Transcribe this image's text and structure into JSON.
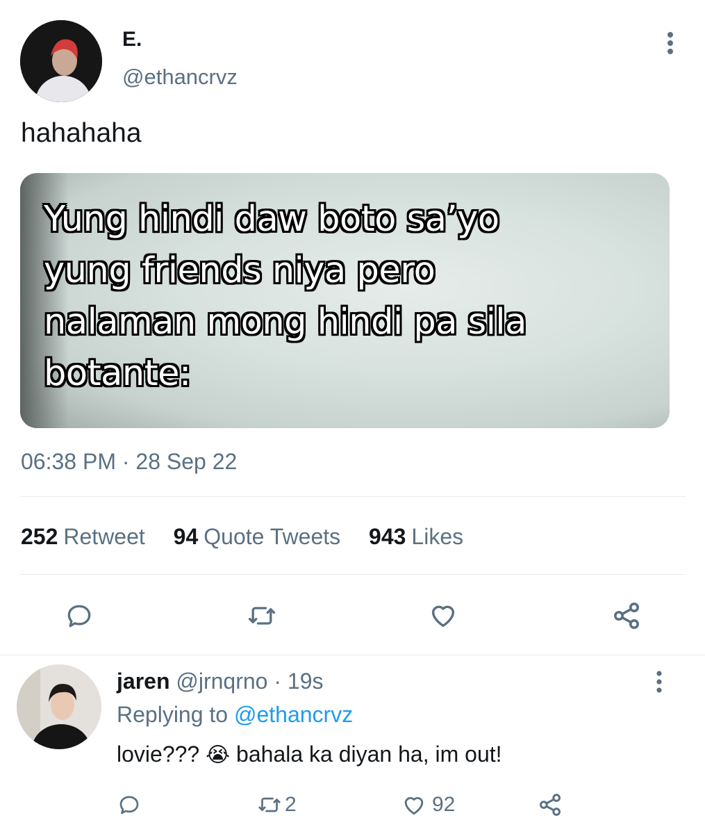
{
  "tweet": {
    "display_name": "E.",
    "handle": "@ethancrvz",
    "text": "hahahaha",
    "media_caption": [
      "Yung hindi daw boto sa’yo",
      "yung friends niya pero",
      "nalaman mong hindi pa sila",
      "botante:"
    ],
    "timestamp": "06:38 PM · 28 Sep 22",
    "stats": {
      "retweets_count": "252",
      "retweets_label": "Retweet",
      "quotes_count": "94",
      "quotes_label": "Quote Tweets",
      "likes_count": "943",
      "likes_label": "Likes"
    },
    "actions": [
      "reply-icon",
      "retweet-icon",
      "like-icon",
      "share-icon"
    ]
  },
  "reply": {
    "display_name": "jaren",
    "handle": "@jrnqrno",
    "age": "· 19s",
    "replying_prefix": "Replying to",
    "replying_handle": "@ethancrvz",
    "text_before": "lovie???",
    "emoji": "😭",
    "text_after": "bahala ka diyan ha, im out!",
    "retweets": "2",
    "likes": "92"
  },
  "colors": {
    "text": "#14171a",
    "muted": "#5b7083",
    "link": "#1d9bf0",
    "divider": "#e6ecf0"
  }
}
